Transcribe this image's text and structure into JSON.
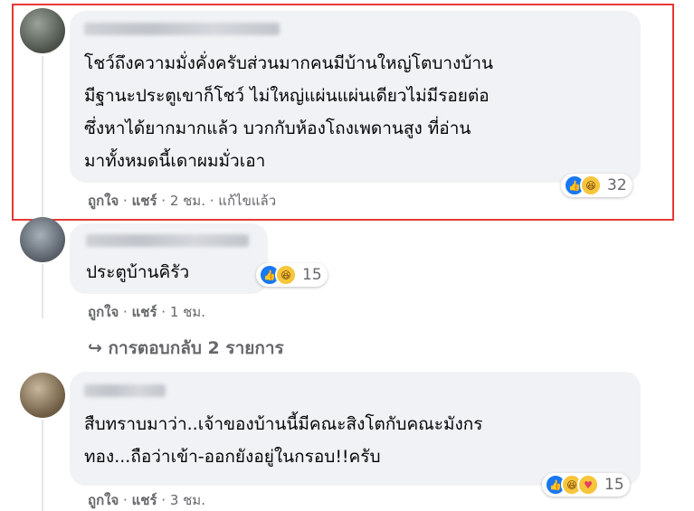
{
  "comments": [
    {
      "lines": [
        "โชว์ถึงความมั่งคั่งครับส่วนมากคนมีบ้านใหญ่โตบางบ้าน",
        "มีฐานะประตูเขาก็โชว์ ไม่ใหญ่แผ่นแผ่นเดียวไม่มีรอยต่อ",
        "ซึ่งหาได้ยากมากแล้ว บวกกับห้องโถงเพดานสูง ที่อ่าน",
        "มาทั้งหมดนี้เดาผมมั่วเอา"
      ],
      "like": "ถูกใจ",
      "share": "แชร์",
      "time": "2 ชม.",
      "edited": "แก้ไขแล้ว",
      "reaction_count": "32"
    },
    {
      "lines": [
        "ประตูบ้านคิรัว"
      ],
      "like": "ถูกใจ",
      "share": "แชร์",
      "time": "1 ชม.",
      "reaction_count": "15"
    },
    {
      "lines": [
        "สืบทราบมาว่า..เจ้าของบ้านนี้มีคณะสิงโตกับคณะมังกร",
        "ทอง...ถือว่าเข้า-ออกยังอยู่ในกรอบ!!ครับ"
      ],
      "like": "ถูกใจ",
      "share": "แชร์",
      "time": "3 ชม.",
      "reaction_count": "15"
    }
  ],
  "replies_label": "↪ การตอบกลับ 2 รายการ",
  "separator": " · ",
  "colors": {
    "bubble": "#f0f2f5",
    "highlight": "#e53935",
    "like_blue": "#1877f2",
    "haha_yellow": "#f7c53a",
    "muted_text": "#65676b"
  },
  "icons": {
    "like": "thumbs-up-icon",
    "haha": "laughing-face-icon",
    "care": "care-face-icon"
  }
}
